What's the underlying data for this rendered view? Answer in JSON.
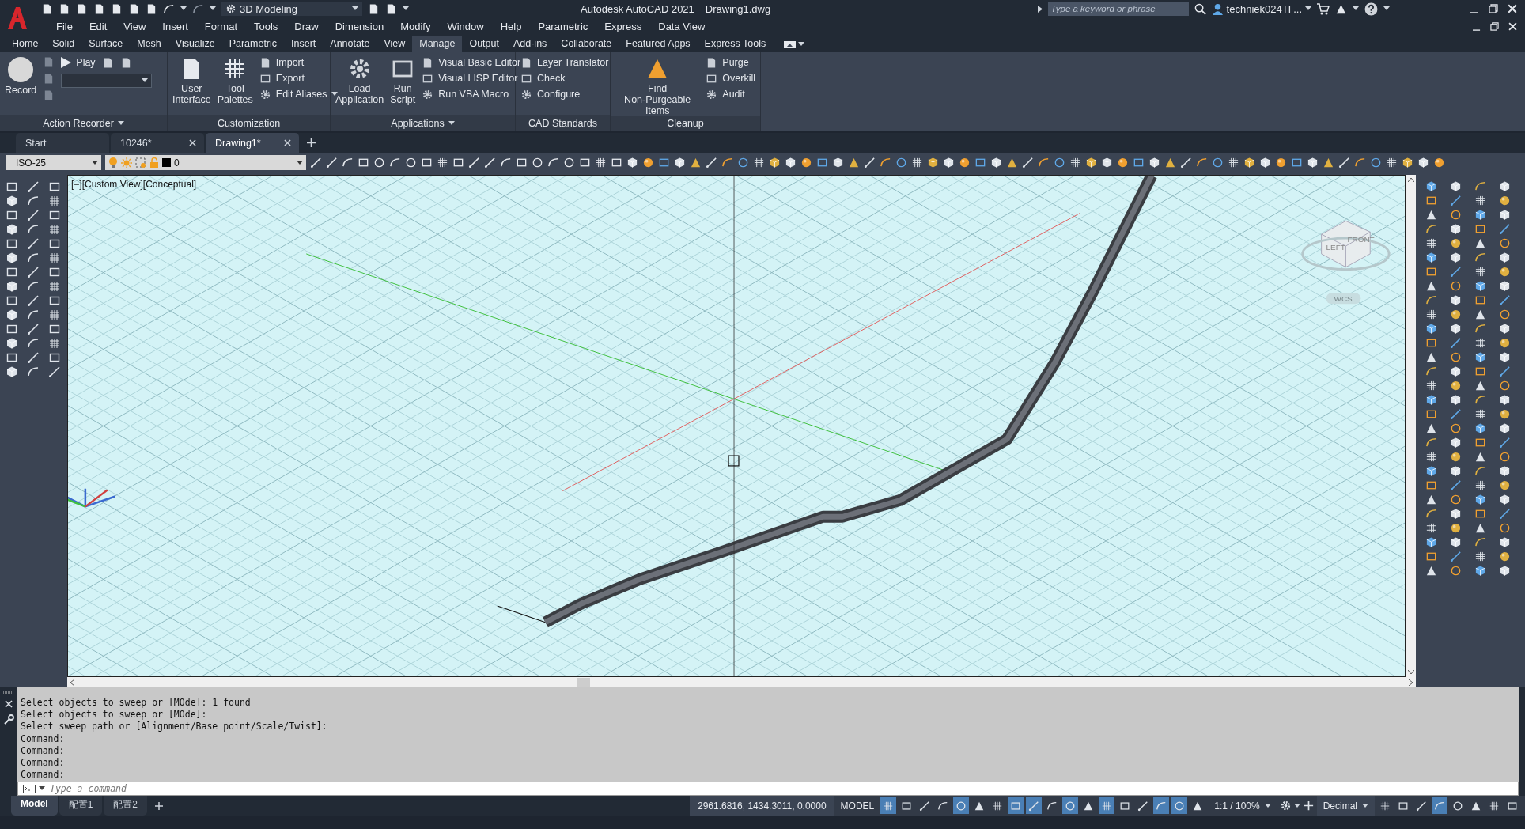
{
  "title_bar": {
    "workspace": "3D Modeling",
    "app_title": "Autodesk AutoCAD 2021",
    "file_name": "Drawing1.dwg",
    "search": {
      "placeholder": "Type a keyword or phrase"
    },
    "user": "techniek024TF..."
  },
  "menu_bar": [
    "File",
    "Edit",
    "View",
    "Insert",
    "Format",
    "Tools",
    "Draw",
    "Dimension",
    "Modify",
    "Window",
    "Help",
    "Parametric",
    "Express",
    "Data View"
  ],
  "ribbon_tabs": [
    {
      "label": "Home",
      "selected": false
    },
    {
      "label": "Solid",
      "selected": false
    },
    {
      "label": "Surface",
      "selected": false
    },
    {
      "label": "Mesh",
      "selected": false
    },
    {
      "label": "Visualize",
      "selected": false
    },
    {
      "label": "Parametric",
      "selected": false
    },
    {
      "label": "Insert",
      "selected": false
    },
    {
      "label": "Annotate",
      "selected": false
    },
    {
      "label": "View",
      "selected": false
    },
    {
      "label": "Manage",
      "selected": true
    },
    {
      "label": "Output",
      "selected": false
    },
    {
      "label": "Add-ins",
      "selected": false
    },
    {
      "label": "Collaborate",
      "selected": false
    },
    {
      "label": "Featured Apps",
      "selected": false
    },
    {
      "label": "Express Tools",
      "selected": false
    }
  ],
  "ribbon_panels": [
    {
      "title": "Action Recorder",
      "has_menu": true,
      "tools": [
        {
          "kind": "large",
          "label": "Record"
        },
        {
          "kind": "play",
          "label": "Play"
        }
      ]
    },
    {
      "title": "Customization",
      "has_menu": false,
      "tools": [
        {
          "kind": "large",
          "label": "User\nInterface"
        },
        {
          "kind": "large",
          "label": "Tool\nPalettes"
        },
        {
          "kind": "stack",
          "items": [
            {
              "label": "Import",
              "has_menu": false
            },
            {
              "label": "Export",
              "has_menu": false
            },
            {
              "label": "Edit Aliases",
              "has_menu": true
            }
          ]
        }
      ]
    },
    {
      "title": "Applications",
      "has_menu": true,
      "tools": [
        {
          "kind": "large",
          "label": "Load\nApplication"
        },
        {
          "kind": "large",
          "label": "Run\nScript"
        },
        {
          "kind": "stack",
          "items": [
            {
              "label": "Visual Basic Editor",
              "has_menu": false
            },
            {
              "label": "Visual LISP Editor",
              "has_menu": false
            },
            {
              "label": "Run VBA Macro",
              "has_menu": false
            }
          ]
        }
      ]
    },
    {
      "title": "CAD Standards",
      "has_menu": false,
      "tools": [
        {
          "kind": "stack",
          "items": [
            {
              "label": "Layer Translator",
              "has_menu": false
            },
            {
              "label": "Check",
              "has_menu": false
            },
            {
              "label": "Configure",
              "has_menu": false
            }
          ]
        }
      ]
    },
    {
      "title": "Cleanup",
      "has_menu": false,
      "tools": [
        {
          "kind": "large",
          "label": "Find\nNon-Purgeable Items"
        },
        {
          "kind": "stack",
          "items": [
            {
              "label": "Purge",
              "has_menu": false
            },
            {
              "label": "Overkill",
              "has_menu": false
            },
            {
              "label": "Audit",
              "has_menu": false
            }
          ]
        }
      ]
    }
  ],
  "document_tabs": [
    {
      "label": "Start",
      "selected": false,
      "closable": false
    },
    {
      "label": "10246*",
      "selected": false,
      "closable": true
    },
    {
      "label": "Drawing1*",
      "selected": true,
      "closable": true
    }
  ],
  "properties_toolbar": {
    "dim_style": "ISO-25",
    "layer": "0"
  },
  "viewport": {
    "label": "[−][Custom View][Conceptual]",
    "viewcube": {
      "faces": [
        "LEFT",
        "FRONT"
      ],
      "coordinate_system": "WCS"
    }
  },
  "command_history": [
    "Select objects to sweep or [MOde]: 1 found",
    "Select objects to sweep or [MOde]:",
    "Select sweep path or [Alignment/Base point/Scale/Twist]:",
    "Command:",
    "Command:",
    "Command:",
    "Command:"
  ],
  "command_input": {
    "placeholder": "Type a command"
  },
  "layout_tabs": [
    {
      "label": "Model",
      "selected": true
    },
    {
      "label": "配置1",
      "selected": false
    },
    {
      "label": "配置2",
      "selected": false
    }
  ],
  "status_bar": {
    "coordinates": "2961.6816, 1434.3011, 0.0000",
    "space": "MODEL",
    "toggles": [
      {
        "on": true
      },
      {
        "on": false
      },
      {
        "on": false
      },
      {
        "on": false
      },
      {
        "on": true
      },
      {
        "on": false
      },
      {
        "on": false
      },
      {
        "on": true
      },
      {
        "on": true
      },
      {
        "on": false
      },
      {
        "on": true
      },
      {
        "on": false
      },
      {
        "on": true
      },
      {
        "on": false
      },
      {
        "on": false
      },
      {
        "on": true
      },
      {
        "on": true
      },
      {
        "on": false
      }
    ],
    "annotation_scale": "1:1 / 100%",
    "units": "Decimal",
    "end_toggles": [
      {
        "on": false
      },
      {
        "on": false
      },
      {
        "on": false
      },
      {
        "on": true
      },
      {
        "on": false
      },
      {
        "on": false
      },
      {
        "on": false
      },
      {
        "on": false
      }
    ]
  }
}
